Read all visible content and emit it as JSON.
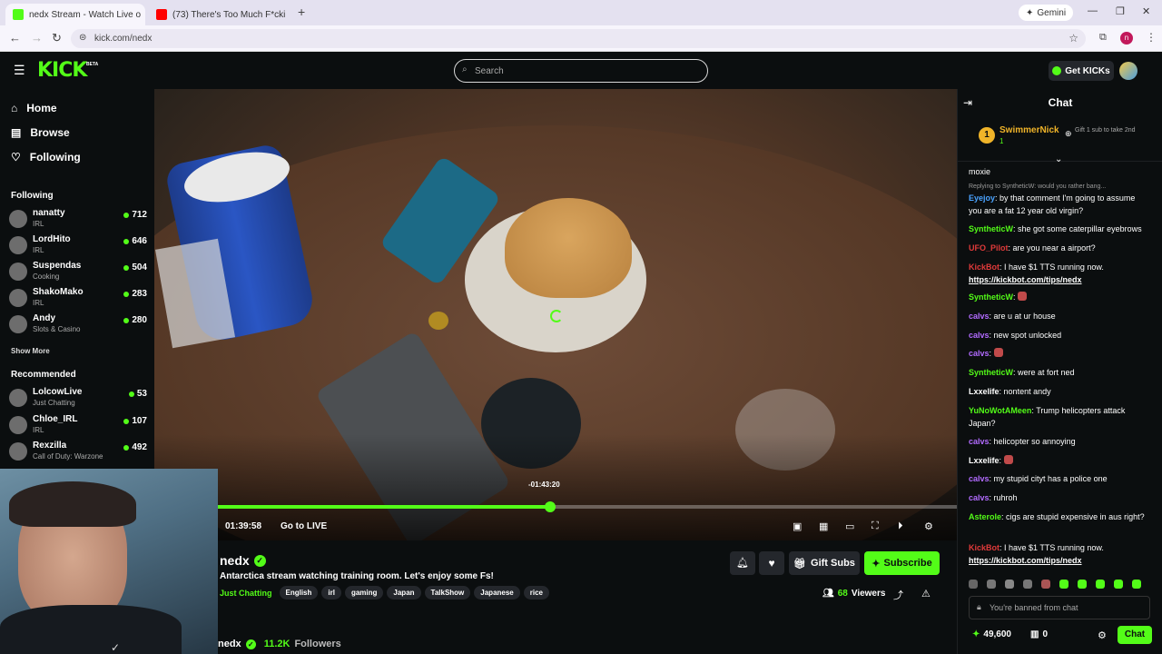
{
  "browser": {
    "tabs": [
      {
        "title": "nedx Stream - Watch Live o",
        "active": true
      },
      {
        "title": "(73) There's Too Much F*cki",
        "active": false
      }
    ],
    "gemini_label": "Gemini",
    "url": "kick.com/nedx"
  },
  "header": {
    "logo": "KICK",
    "logo_badge": "BETA",
    "search_placeholder": "Search",
    "get_kicks_label": "Get KICKs"
  },
  "sidebar": {
    "nav": [
      {
        "label": "Home",
        "icon": "home-icon"
      },
      {
        "label": "Browse",
        "icon": "browse-icon"
      },
      {
        "label": "Following",
        "icon": "heart-icon"
      }
    ],
    "following_title": "Following",
    "following": [
      {
        "name": "nanatty",
        "category": "IRL",
        "viewers": "712"
      },
      {
        "name": "LordHito",
        "category": "IRL",
        "viewers": "646"
      },
      {
        "name": "Suspendas",
        "category": "Cooking",
        "viewers": "504"
      },
      {
        "name": "ShakoMako",
        "category": "IRL",
        "viewers": "283"
      },
      {
        "name": "Andy",
        "category": "Slots & Casino",
        "viewers": "280"
      }
    ],
    "show_more": "Show More",
    "recommended_title": "Recommended",
    "recommended": [
      {
        "name": "LolcowLive",
        "category": "Just Chatting",
        "viewers": "53"
      },
      {
        "name": "Chloe_IRL",
        "category": "IRL",
        "viewers": "107"
      },
      {
        "name": "Rexzilla",
        "category": "Call of Duty: Warzone",
        "viewers": "492"
      }
    ]
  },
  "player": {
    "seek_tooltip": "-01:43:20",
    "current_time": "01:39:58",
    "go_live_label": "Go to LIVE",
    "progress": 0.45
  },
  "stream": {
    "channel": "nedx",
    "title": "Antarctica stream watching training room. Let's enjoy some Fs!",
    "category": "Just Chatting",
    "tags": [
      "English",
      "irl",
      "gaming",
      "Japan",
      "TalkShow",
      "Japanese",
      "rice"
    ],
    "gift_subs_label": "Gift Subs",
    "subscribe_label": "Subscribe",
    "viewers_count": "68",
    "viewers_label": "Viewers",
    "followers_count": "11.2K",
    "followers_label": "Followers"
  },
  "chat": {
    "title": "Chat",
    "pinned_user": "SwimmerNick",
    "pinned_rank": "1",
    "pinned_count": "1",
    "gift_hint": "Gift 1 sub to take 2nd",
    "messages": [
      {
        "user": "",
        "text": "moxie",
        "color": "#ffffff"
      },
      {
        "user": "",
        "text": "Replying to SyntheticW: would you rather bang...",
        "color": "#9a9a9a",
        "reply": true
      },
      {
        "user": "Eyejoy",
        "text": "by that comment I'm going to assume you are a fat 12 year old virgin?",
        "color": "#4aa3ff"
      },
      {
        "user": "SyntheticW",
        "text": "she got some caterpillar eyebrows",
        "color": "#53fc18"
      },
      {
        "user": "UFO_Pilot",
        "text": "are you near a airport?",
        "color": "#e03a3a"
      },
      {
        "user": "KickBot",
        "text": "I have $1 TTS running now.",
        "color": "#e03a3a",
        "link": "https://kickbot.com/tips/nedx"
      },
      {
        "user": "SyntheticW",
        "text": "",
        "color": "#53fc18"
      },
      {
        "user": "calvs",
        "text": "are u at ur house",
        "color": "#b26bff"
      },
      {
        "user": "calvs",
        "text": "new spot unlocked",
        "color": "#b26bff"
      },
      {
        "user": "calvs",
        "text": "",
        "color": "#b26bff"
      },
      {
        "user": "SyntheticW",
        "text": "were at fort ned",
        "color": "#53fc18"
      },
      {
        "user": "Lxxelife",
        "text": "nontent andy",
        "color": "#ffffff"
      },
      {
        "user": "YuNoWotAMeen",
        "text": "Trump helicopters attack Japan?",
        "color": "#53fc18"
      },
      {
        "user": "calvs",
        "text": "helicopter so annoying",
        "color": "#b26bff"
      },
      {
        "user": "Lxxelife",
        "text": "",
        "color": "#ffffff"
      },
      {
        "user": "calvs",
        "text": "my stupid cityt has a police one",
        "color": "#b26bff"
      },
      {
        "user": "calvs",
        "text": "ruhroh",
        "color": "#b26bff"
      },
      {
        "user": "Asterole",
        "text": "cigs are stupid expensive in aus right?",
        "color": "#53fc18"
      },
      {
        "user": "KickBot",
        "text": "I have $1 TTS running now.",
        "color": "#e03a3a",
        "link": "https://kickbot.com/tips/nedx"
      }
    ],
    "banned_text": "You're banned from chat",
    "points": "49,600",
    "points2": "0",
    "chat_button": "Chat"
  },
  "colors": {
    "accent": "#53fc18",
    "bg": "#0b0e0f",
    "panel": "#24272c"
  }
}
